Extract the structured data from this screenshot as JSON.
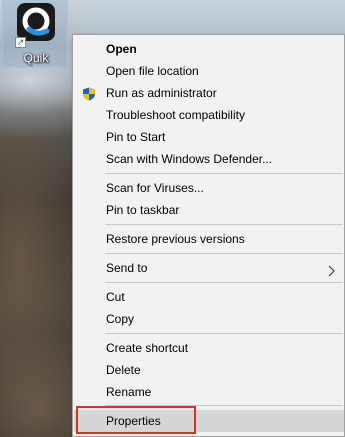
{
  "desktop": {
    "icon": {
      "label": "Quik",
      "icon_name": "quik-app-icon",
      "shortcut_icon_name": "shortcut-arrow-icon"
    }
  },
  "menu": {
    "items": [
      {
        "label": "Open",
        "bold": true
      },
      {
        "label": "Open file location"
      },
      {
        "label": "Run as administrator",
        "icon": "uac-shield-icon"
      },
      {
        "label": "Troubleshoot compatibility"
      },
      {
        "label": "Pin to Start"
      },
      {
        "label": "Scan with Windows Defender..."
      },
      {
        "label": "Scan for Viruses..."
      },
      {
        "label": "Pin to taskbar"
      },
      {
        "label": "Restore previous versions"
      },
      {
        "label": "Send to",
        "submenu": true
      },
      {
        "label": "Cut"
      },
      {
        "label": "Copy"
      },
      {
        "label": "Create shortcut"
      },
      {
        "label": "Delete"
      },
      {
        "label": "Rename"
      },
      {
        "label": "Properties",
        "highlighted": true
      }
    ]
  },
  "colors": {
    "menu_background": "#f2f2f2",
    "hover_background": "#d6d6d6",
    "highlight_border": "#e0301e",
    "shield_blue": "#1f5fbf",
    "shield_yellow": "#f0c020"
  }
}
